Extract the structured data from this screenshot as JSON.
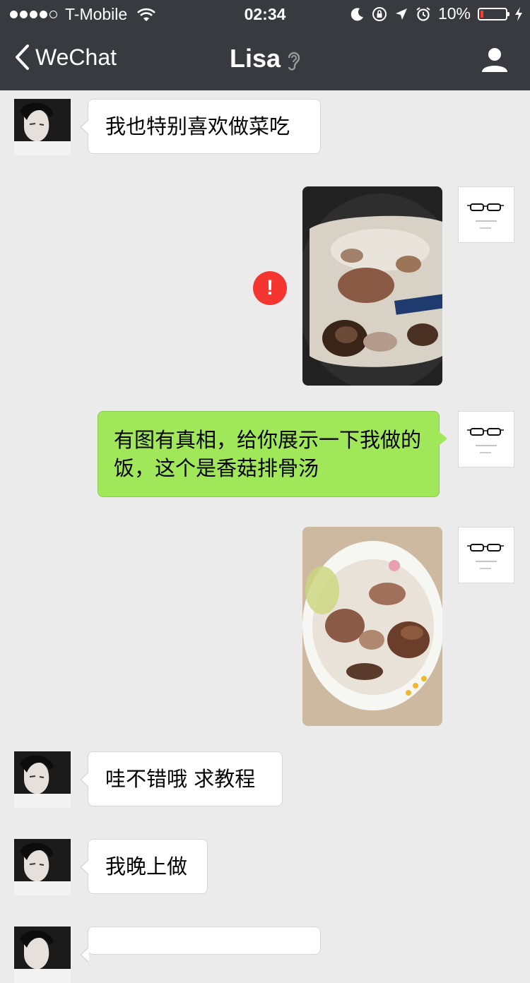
{
  "status_bar": {
    "carrier": "T-Mobile",
    "time": "02:34",
    "battery": "10%",
    "signal_bars": 4
  },
  "nav": {
    "back_label": "WeChat",
    "title": "Lisa"
  },
  "messages": [
    {
      "from": "Lisa",
      "text": "我也特别喜欢做菜吃"
    },
    {
      "from": "me",
      "type": "image",
      "content": "pot of mushroom and pork rib soup",
      "status": "send-failed"
    },
    {
      "from": "me",
      "text": "有图有真相，给你展示一下我做的饭，这个是香菇排骨汤"
    },
    {
      "from": "me",
      "type": "image",
      "content": "bowl of mushroom and pork rib soup"
    },
    {
      "from": "Lisa",
      "text": "哇不错哦 求教程"
    },
    {
      "from": "Lisa",
      "text": "我晚上做"
    }
  ],
  "colors": {
    "nav_bg": "#393a3f",
    "chat_bg": "#ebebeb",
    "outgoing_bubble": "#a0e75a",
    "error_badge": "#f43530"
  }
}
